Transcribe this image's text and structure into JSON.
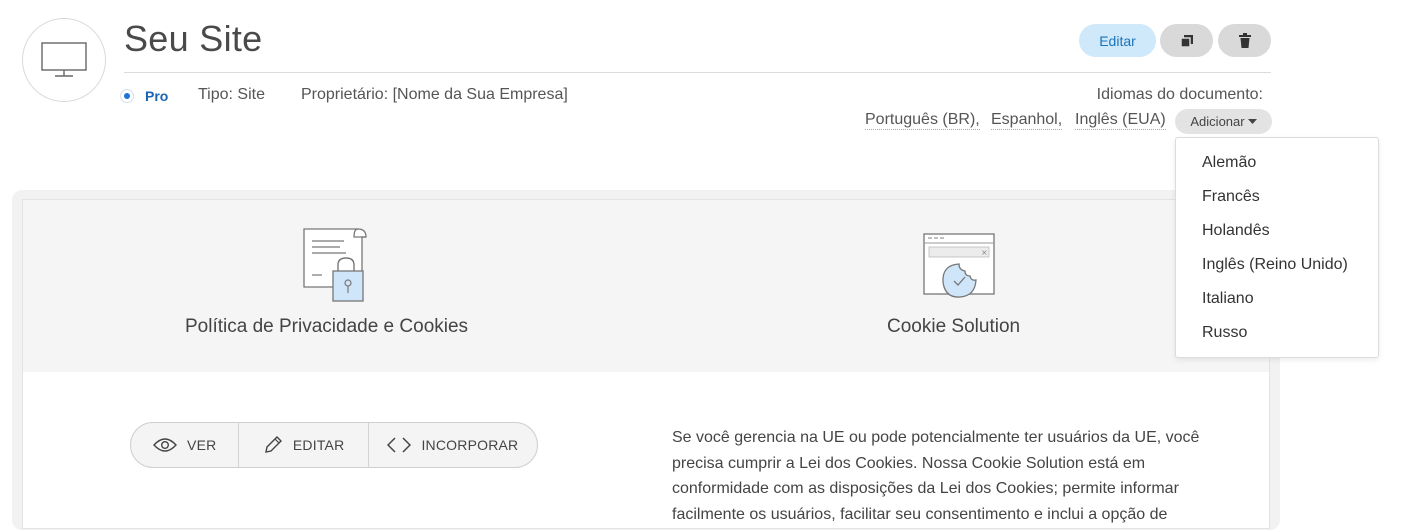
{
  "header": {
    "title": "Seu Site",
    "avatar_icon": "monitor-icon",
    "edit_label": "Editar",
    "copy_icon": "copy-icon",
    "delete_icon": "trash-icon"
  },
  "meta": {
    "plan": "Pro",
    "type": "Tipo: Site",
    "owner": "Proprietário: [Nome da Sua Empresa]"
  },
  "languages": {
    "label": "Idiomas do documento:",
    "items": [
      "Português (BR),",
      "Espanhol,",
      "Inglês (EUA)"
    ],
    "add_label": "Adicionar",
    "dropdown": [
      "Alemão",
      "Francês",
      "Holandês",
      "Inglês (Reino Unido)",
      "Italiano",
      "Russo"
    ]
  },
  "products": [
    {
      "title": "Política de Privacidade e Cookies",
      "icon": "document-lock-icon"
    },
    {
      "title": "Cookie Solution",
      "icon": "cookie-window-icon"
    }
  ],
  "actions": {
    "view": "VER",
    "edit": "EDITAR",
    "embed": "INCORPORAR"
  },
  "description": "Se você gerencia na UE ou pode potencialmente ter usuários da UE, você precisa cumprir a Lei dos Cookies. Nossa Cookie Solution está em conformidade com as disposições da Lei dos Cookies; permite informar facilmente os usuários, facilitar seu consentimento e inclui a opção de",
  "colors": {
    "accent": "#1a74b9",
    "edit_bg": "#cfe8fa",
    "pro": "#1a64b6"
  }
}
